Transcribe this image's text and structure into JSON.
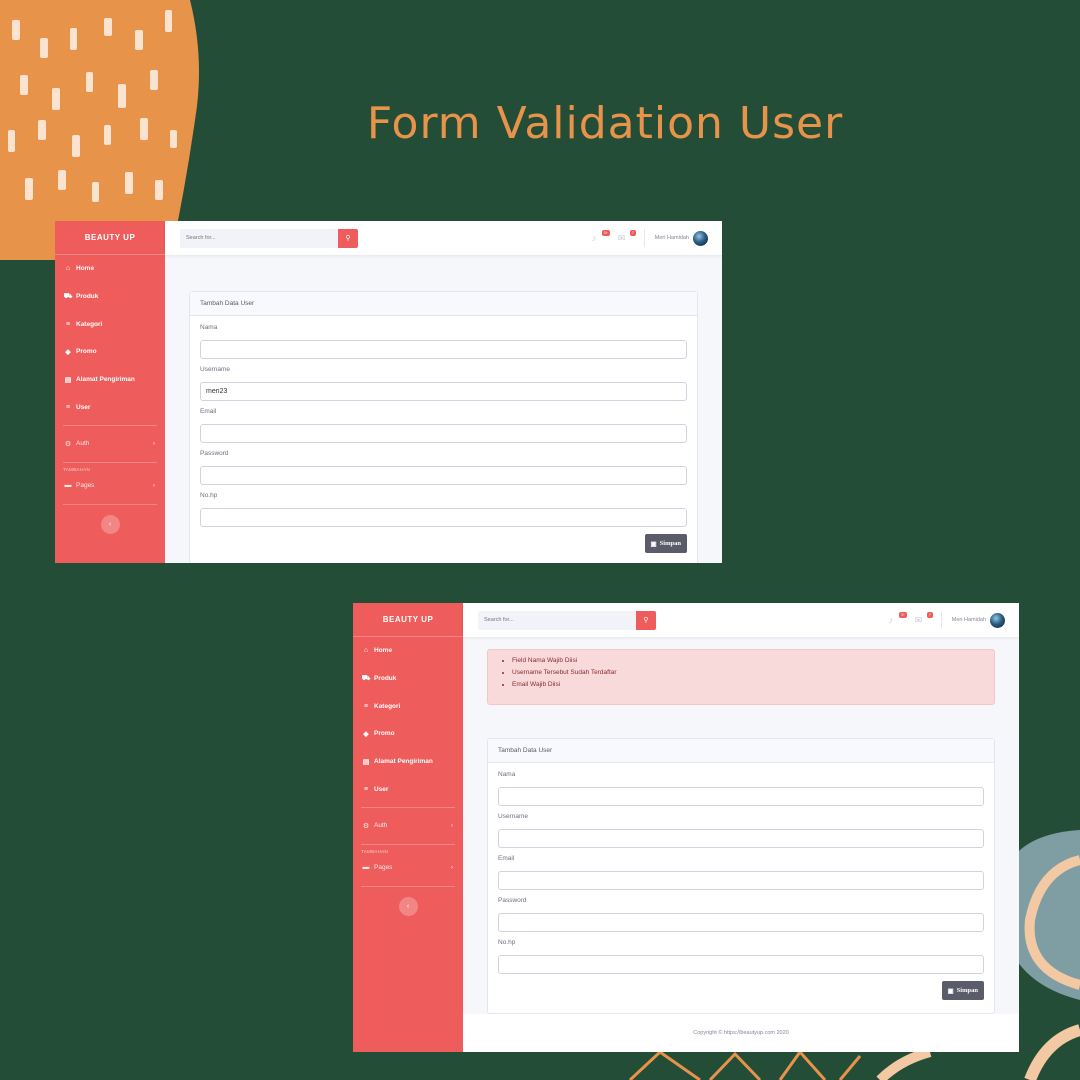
{
  "headline": "Form Validation User",
  "app": {
    "brand": "BEAUTY UP",
    "search_placeholder": "Search for...",
    "user_name": "Meri Hamidah",
    "alerts_badge": "3+",
    "messages_badge": "7",
    "sidebar": {
      "items": [
        {
          "icon": "home-icon",
          "glyph": "⌂",
          "label": "Home"
        },
        {
          "icon": "cart-icon",
          "glyph": "⛟",
          "label": "Produk"
        },
        {
          "icon": "list-icon",
          "glyph": "≡",
          "label": "Kategori"
        },
        {
          "icon": "tag-icon",
          "glyph": "◆",
          "label": "Promo"
        },
        {
          "icon": "address-card-icon",
          "glyph": "▤",
          "label": "Alamat Pengiriman"
        },
        {
          "icon": "list-icon",
          "glyph": "≡",
          "label": "User"
        }
      ],
      "auth_label": "Auth",
      "heading": "TAMBAHAN",
      "pages_label": "Pages"
    },
    "form": {
      "title": "Tambah Data User",
      "labels": {
        "nama": "Nama",
        "username": "Username",
        "email": "Email",
        "password": "Password",
        "nohp": "No.hp"
      },
      "submit_label": "Simpan"
    }
  },
  "screen1": {
    "username_value": "meri23"
  },
  "screen2": {
    "errors": [
      "Field Nama Wajib Diisi",
      "Username Tersebut Sudah Terdaftar",
      "Email Wajib Diisi"
    ],
    "footer": "Copyright © https://beautyup.com 2020"
  },
  "colors": {
    "background": "#244d38",
    "accent": "#ee5c5c",
    "headline": "#e8934a",
    "decor_orange": "#e8934a",
    "decor_teal": "#7f9ea3"
  }
}
